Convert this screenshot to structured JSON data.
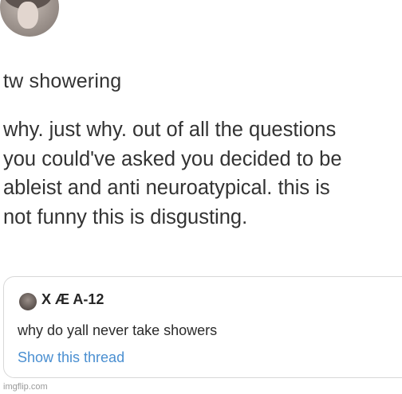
{
  "reply": {
    "trigger_warning": "tw showering",
    "lines": [
      "why. just why. out of all the questions",
      "you could've asked you decided to be",
      "ableist and anti neuroatypical. this is",
      "not funny this is disgusting."
    ]
  },
  "quoted_tweet": {
    "author_name": "X Æ A-12",
    "text": "why do yall never take showers",
    "show_thread_label": "Show this thread",
    "link_color": "#4a8fd1"
  },
  "watermark": "imgflip.com"
}
